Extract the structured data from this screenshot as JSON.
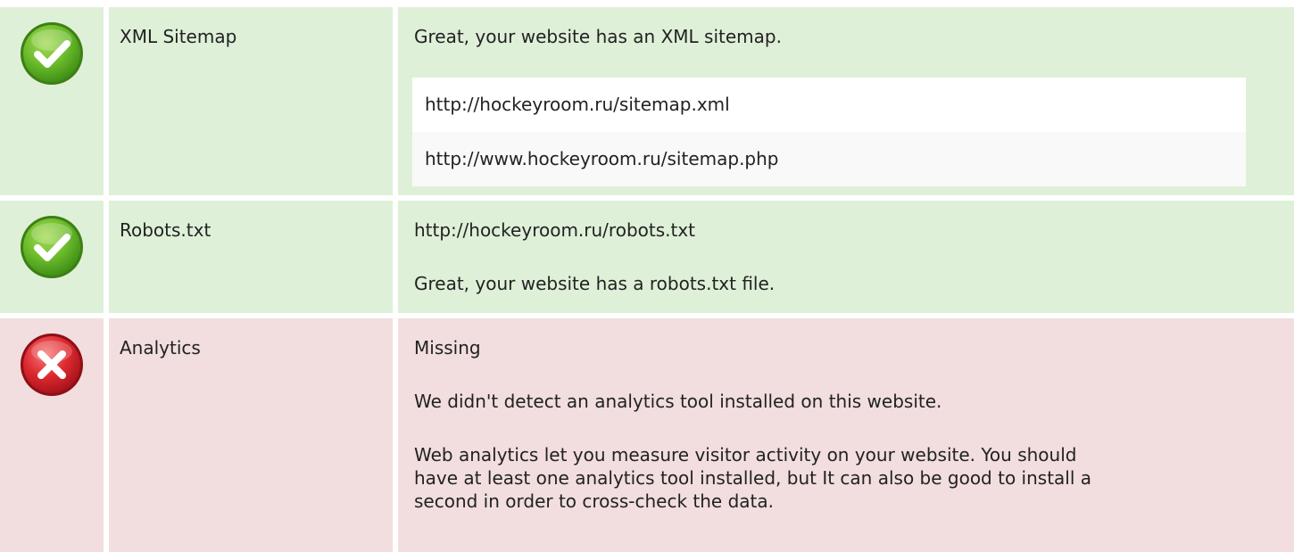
{
  "checks": [
    {
      "status": "pass",
      "icon": "check-icon",
      "label": "XML Sitemap",
      "message": "Great, your website has an XML sitemap.",
      "urls": [
        "http://hockeyroom.ru/sitemap.xml",
        "http://www.hockeyroom.ru/sitemap.php"
      ]
    },
    {
      "status": "pass",
      "icon": "check-icon",
      "label": "Robots.txt",
      "url": "http://hockeyroom.ru/robots.txt",
      "message": "Great, your website has a robots.txt file."
    },
    {
      "status": "fail",
      "icon": "cross-icon",
      "label": "Analytics",
      "value": "Missing",
      "message": "We didn't detect an analytics tool installed on this website.",
      "description": "Web analytics let you measure visitor activity on your website. You should have at least one analytics tool installed, but It can also be good to install a second in order to cross-check the data."
    }
  ],
  "colors": {
    "pass_background": "#dff0d8",
    "fail_background": "#f2dede",
    "pass_icon": "#5cb02a",
    "fail_icon": "#d9232e"
  }
}
